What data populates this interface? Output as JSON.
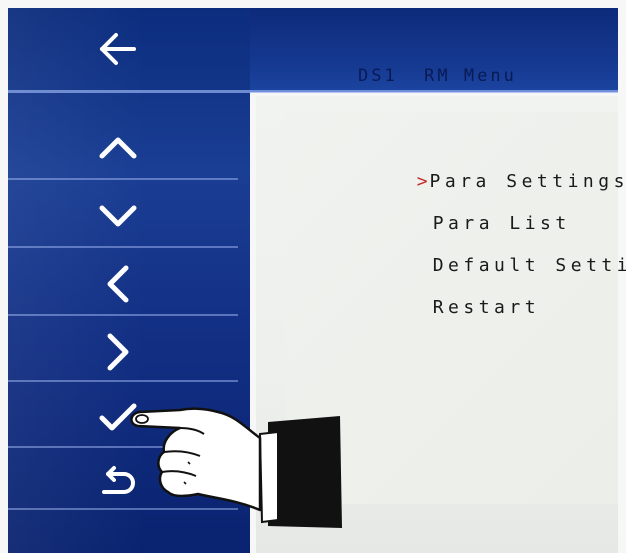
{
  "header": {
    "title": "DS1  RM Menu"
  },
  "nav": {
    "buttons": [
      {
        "name": "back-button",
        "icon": "arrow-left-icon"
      },
      {
        "name": "up-button",
        "icon": "chevron-up-icon"
      },
      {
        "name": "down-button",
        "icon": "chevron-down-icon"
      },
      {
        "name": "left-button",
        "icon": "chevron-left-icon"
      },
      {
        "name": "right-button",
        "icon": "chevron-right-icon"
      },
      {
        "name": "confirm-button",
        "icon": "checkmark-icon"
      },
      {
        "name": "return-button",
        "icon": "return-icon"
      }
    ]
  },
  "menu": {
    "cursor": ">",
    "items": [
      {
        "label": "Para Settings",
        "selected": true
      },
      {
        "label": "Para List",
        "selected": false
      },
      {
        "label": "Default Setting",
        "selected": false
      },
      {
        "label": "Restart",
        "selected": false
      }
    ]
  },
  "colors": {
    "panel_blue": "#122f84",
    "cursor_red": "#c62a2a",
    "menu_bg": "#eef0ee",
    "text": "#1a1a1a"
  }
}
